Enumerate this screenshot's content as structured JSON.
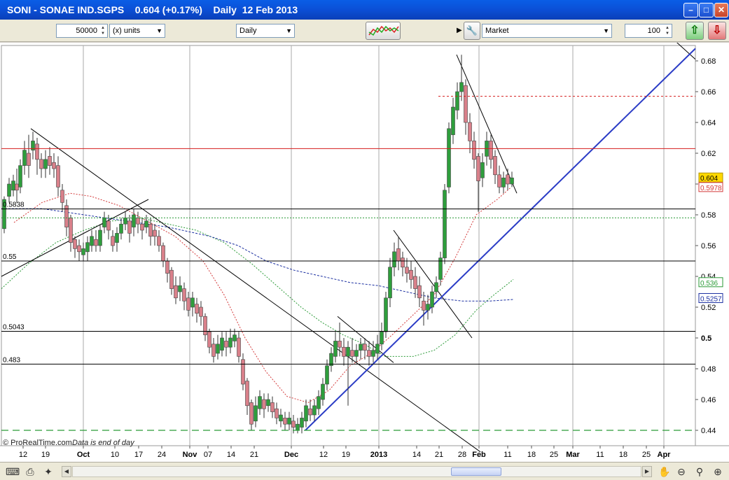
{
  "window": {
    "title": "SONI - SONAE IND.SGPS    0.604 (+0.17%)    Daily  12 Feb 2013"
  },
  "toolbar": {
    "quantity": "50000",
    "units": "(x) units",
    "period": "Daily",
    "order_type": "Market",
    "order_qty": "100"
  },
  "chart_data": {
    "type": "candlestick",
    "ylim": [
      0.43,
      0.69
    ],
    "y_ticks": [
      "0.68",
      "0.66",
      "0.64",
      "0.62",
      "0.6",
      "0.58",
      "0.56",
      "0.54",
      "0.52",
      "0.5",
      "0.48",
      "0.46",
      "0.44"
    ],
    "x_ticks": [
      "12",
      "19",
      "Oct",
      "10",
      "17",
      "24",
      "Nov",
      "07",
      "14",
      "21",
      "Dec",
      "12",
      "19",
      "2013",
      "14",
      "21",
      "28",
      "Feb",
      "11",
      "18",
      "25",
      "Mar",
      "11",
      "18",
      "25",
      "Apr"
    ],
    "levels": [
      {
        "label": "0.5838",
        "value": 0.5838
      },
      {
        "label": "0.55",
        "value": 0.55
      },
      {
        "label": "0.5043",
        "value": 0.5043
      },
      {
        "label": "0.483",
        "value": 0.483
      }
    ],
    "price_tags": [
      {
        "label": "0.604",
        "value": 0.604
      },
      {
        "label": "0.5978",
        "value": 0.5978
      },
      {
        "label": "0.536",
        "value": 0.536
      },
      {
        "label": "0.5257",
        "value": 0.5257
      }
    ],
    "bold_tick": "0.5",
    "footer": "© ProRealTime.com",
    "footer_note": "Data is end of day",
    "colors": {
      "up": "#2e9e3c",
      "down": "#d9808a",
      "ma_red": "#d43a3a",
      "ma_green": "#2a9a36",
      "ma_blue": "#1a2ea0",
      "trend": "#2b3cc6",
      "resistance": "#d41c1c"
    }
  },
  "scrollbar": {}
}
